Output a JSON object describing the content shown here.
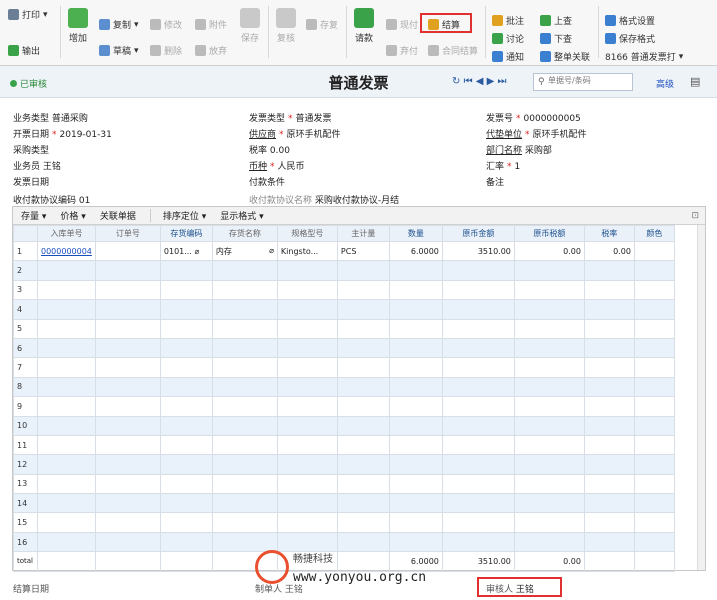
{
  "ribbon": {
    "print": "打印",
    "export": "输出",
    "add": "增加",
    "copy": "复制",
    "modify": "修改",
    "attach": "附件",
    "draft": "草稿",
    "delete": "删除",
    "abandon": "放弃",
    "save": "保存",
    "review": "复核",
    "store": "存复",
    "cur": "现付",
    "settle": "结算",
    "withhold": "请款",
    "pay_off": "弃付",
    "contract_settle": "合同结算",
    "approve_note": "批注",
    "discuss": "讨论",
    "notify": "通知",
    "prev": "上查",
    "next": "下查",
    "whole_link": "整单关联",
    "format_set": "格式设置",
    "save_format": "保存格式",
    "template": "8166 普通发票打"
  },
  "status": {
    "audited": "已审核",
    "title": "普通发票",
    "search_placeholder": "单据号/条码",
    "advanced": "高级"
  },
  "header": {
    "biz_type_label": "业务类型",
    "biz_type": "普通采购",
    "invoice_type_label": "发票类型",
    "invoice_type": "普通发票",
    "invoice_no_label": "发票号",
    "invoice_no": "0000000005",
    "open_date_label": "开票日期",
    "open_date": "2019-01-31",
    "supplier_label": "供应商",
    "supplier": "原环手机配件",
    "agent_label": "代垫单位",
    "agent": "原环手机配件",
    "purchase_type_label": "采购类型",
    "tax_rate_label": "税率",
    "tax_rate": "0.00",
    "dept_label": "部门名称",
    "dept": "采购部",
    "salesman_label": "业务员",
    "salesman": "王铭",
    "currency_label": "币种",
    "currency": "人民币",
    "exchange_label": "汇率",
    "exchange": "1",
    "invoice_date_label": "发票日期",
    "pay_terms_label": "付款条件",
    "remark_label": "备注",
    "pay_agreement_code_label": "收付款协议编码",
    "pay_agreement_code": "01",
    "pay_agreement_name_label": "收付款协议名称",
    "pay_agreement_name": "采购收付款协议-月结"
  },
  "grid_toolbar": {
    "stock": "存量",
    "price": "价格",
    "link": "关联单据",
    "sort": "排序定位",
    "display": "显示格式"
  },
  "columns": [
    "入库单号",
    "订单号",
    "存货编码",
    "存货名称",
    "规格型号",
    "主计量",
    "数量",
    "原币金额",
    "原币税额",
    "税率",
    "颜色"
  ],
  "rows": [
    {
      "n": "1",
      "in_no": "0000000004",
      "order": "",
      "code": "0101...",
      "name": "内存",
      "spec": "Kingsto...",
      "unit": "PCS",
      "qty": "6.0000",
      "amount": "3510.00",
      "tax": "0.00",
      "rate": "0.00"
    }
  ],
  "row_numbers": [
    "2",
    "3",
    "4",
    "5",
    "6",
    "7",
    "8",
    "9",
    "10",
    "11",
    "12",
    "13",
    "14",
    "15",
    "16"
  ],
  "totals": {
    "label": "total",
    "qty": "6.0000",
    "amount": "3510.00",
    "tax": "0.00"
  },
  "footer": {
    "settle_date_label": "结算日期",
    "maker_label": "制单人",
    "maker": "王铭",
    "auditor_label": "审核人",
    "auditor": "王铭"
  },
  "watermark": {
    "brand": "畅捷科技",
    "url": "www.yonyou.org.cn"
  }
}
